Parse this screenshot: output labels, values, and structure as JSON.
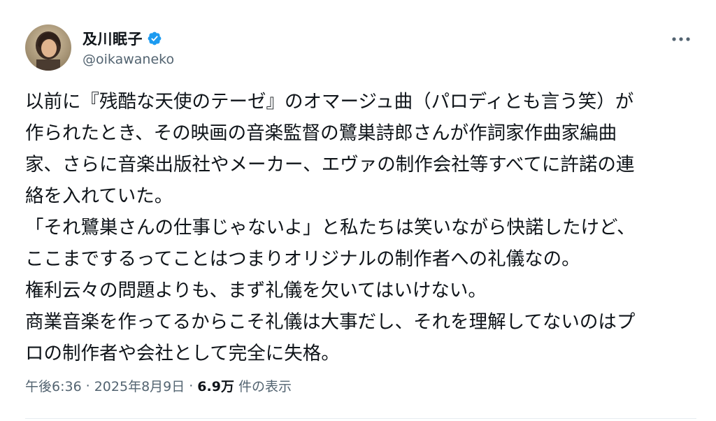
{
  "author": {
    "display_name": "及川眠子",
    "handle": "@oikawaneko",
    "verified": true,
    "verified_color": "#1d9bf0"
  },
  "post": {
    "lines": [
      "以前に『残酷な天使のテーゼ』のオマージュ曲（パロディとも言う笑）が",
      "作られたとき、その映画の音楽監督の鷺巣詩郎さんが作詞家作曲家編曲",
      "家、さらに音楽出版社やメーカー、エヴァの制作会社等すべてに許諾の連",
      "絡を入れていた。",
      "「それ鷺巣さんの仕事じゃないよ」と私たちは笑いながら快諾したけど、",
      "ここまでするってことはつまりオリジナルの制作者への礼儀なの。",
      "権利云々の問題よりも、まず礼儀を欠いてはいけない。",
      "商業音楽を作ってるからこそ礼儀は大事だし、それを理解してないのはプ",
      "ロの制作者や会社として完全に失格。"
    ]
  },
  "meta": {
    "time": "午後6:36",
    "separator": "·",
    "date": "2025年8月9日",
    "views_count": "6.9万",
    "views_label": "件の表示"
  },
  "icons": {
    "more": "more-options-icon",
    "verified": "verified-badge-icon",
    "avatar": "avatar-image"
  },
  "colors": {
    "text_primary": "#0f1419",
    "text_secondary": "#536471",
    "accent": "#1d9bf0"
  }
}
